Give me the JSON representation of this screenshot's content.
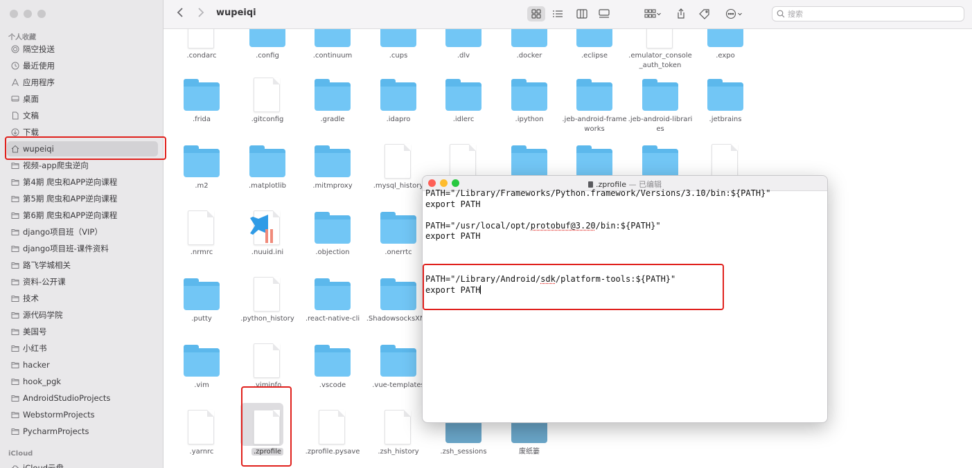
{
  "window": {
    "title": "wupeiqi",
    "colors": {
      "sidebar_bg": "#e9e8ea",
      "folder": "#72c6f5",
      "highlight": "#e0201c"
    }
  },
  "toolbar": {
    "back_icon": "chevron-left-icon",
    "forward_icon": "chevron-right-icon",
    "search_placeholder": "搜索"
  },
  "sidebar": {
    "section_favorites": "个人收藏",
    "section_icloud": "iCloud",
    "items": [
      {
        "label": "隔空投送",
        "icon": "airdrop-icon"
      },
      {
        "label": "最近使用",
        "icon": "clock-icon"
      },
      {
        "label": "应用程序",
        "icon": "apps-icon"
      },
      {
        "label": "桌面",
        "icon": "desktop-icon"
      },
      {
        "label": "文稿",
        "icon": "document-icon"
      },
      {
        "label": "下载",
        "icon": "download-icon"
      },
      {
        "label": "wupeiqi",
        "icon": "home-icon",
        "selected": true
      },
      {
        "label": "视频-app爬虫逆向",
        "icon": "folder-icon"
      },
      {
        "label": "第4期 爬虫和APP逆向课程",
        "icon": "folder-icon"
      },
      {
        "label": "第5期 爬虫和APP逆向课程",
        "icon": "folder-icon"
      },
      {
        "label": "第6期 爬虫和APP逆向课程",
        "icon": "folder-icon"
      },
      {
        "label": "django项目班（VIP）",
        "icon": "folder-icon"
      },
      {
        "label": "django项目班-课件资料",
        "icon": "folder-icon"
      },
      {
        "label": "路飞学城相关",
        "icon": "folder-icon"
      },
      {
        "label": "资料-公开课",
        "icon": "folder-icon"
      },
      {
        "label": "技术",
        "icon": "folder-icon"
      },
      {
        "label": "源代码学院",
        "icon": "folder-icon"
      },
      {
        "label": "美国号",
        "icon": "folder-icon"
      },
      {
        "label": "小红书",
        "icon": "folder-icon"
      },
      {
        "label": "hacker",
        "icon": "folder-icon"
      },
      {
        "label": "hook_pgk",
        "icon": "folder-icon"
      },
      {
        "label": "AndroidStudioProjects",
        "icon": "folder-icon"
      },
      {
        "label": "WebstormProjects",
        "icon": "folder-icon"
      },
      {
        "label": "PycharmProjects",
        "icon": "folder-icon"
      },
      {
        "label": "iCloud云盘",
        "icon": "icloud-icon"
      }
    ]
  },
  "files": {
    "row1": [
      {
        "name": ".condarc",
        "kind": "file"
      },
      {
        "name": ".config",
        "kind": "folder"
      },
      {
        "name": ".continuum",
        "kind": "folder"
      },
      {
        "name": ".cups",
        "kind": "folder"
      },
      {
        "name": ".dlv",
        "kind": "folder"
      },
      {
        "name": ".docker",
        "kind": "folder"
      },
      {
        "name": ".eclipse",
        "kind": "folder"
      },
      {
        "name": ".emulator_console_auth_token",
        "kind": "file"
      },
      {
        "name": ".expo",
        "kind": "folder"
      }
    ],
    "row2": [
      {
        "name": ".frida",
        "kind": "folder"
      },
      {
        "name": ".gitconfig",
        "kind": "file"
      },
      {
        "name": ".gradle",
        "kind": "folder"
      },
      {
        "name": ".idapro",
        "kind": "folder"
      },
      {
        "name": ".idlerc",
        "kind": "folder"
      },
      {
        "name": ".ipython",
        "kind": "folder"
      },
      {
        "name": ".jeb-android-frameworks",
        "kind": "folder"
      },
      {
        "name": ".jeb-android-libraries",
        "kind": "folder"
      },
      {
        "name": ".jetbrains",
        "kind": "folder"
      }
    ],
    "row3": [
      {
        "name": ".m2",
        "kind": "folder"
      },
      {
        "name": ".matplotlib",
        "kind": "folder"
      },
      {
        "name": ".mitmproxy",
        "kind": "folder"
      },
      {
        "name": ".mysql_history",
        "kind": "file"
      },
      {
        "name": "",
        "kind": "file"
      },
      {
        "name": "",
        "kind": "folder"
      },
      {
        "name": "",
        "kind": "folder"
      },
      {
        "name": "",
        "kind": "folder"
      },
      {
        "name": "",
        "kind": "file"
      }
    ],
    "row4": [
      {
        "name": ".nrmrc",
        "kind": "file"
      },
      {
        "name": ".nuuid.ini",
        "kind": "vscode"
      },
      {
        "name": ".objection",
        "kind": "folder"
      },
      {
        "name": ".onerrtc",
        "kind": "folder"
      }
    ],
    "row5": [
      {
        "name": ".putty",
        "kind": "folder"
      },
      {
        "name": ".python_history",
        "kind": "file"
      },
      {
        "name": ".react-native-cli",
        "kind": "folder"
      },
      {
        "name": ".ShadowsocksXNG",
        "kind": "folder"
      }
    ],
    "row6": [
      {
        "name": ".vim",
        "kind": "folder"
      },
      {
        "name": ".viminfo",
        "kind": "file"
      },
      {
        "name": ".vscode",
        "kind": "folder"
      },
      {
        "name": ".vue-templates",
        "kind": "folder"
      }
    ],
    "row7": [
      {
        "name": ".yarnrc",
        "kind": "file"
      },
      {
        "name": ".zprofile",
        "kind": "file",
        "selected": true
      },
      {
        "name": ".zprofile.pysave",
        "kind": "file"
      },
      {
        "name": ".zsh_history",
        "kind": "file"
      },
      {
        "name": ".zsh_sessions",
        "kind": "folder-dim"
      },
      {
        "name": "废纸篓",
        "kind": "folder-dim"
      }
    ]
  },
  "editor": {
    "file_name": ".zprofile",
    "separator": " — ",
    "state": "已编辑",
    "lines": [
      "PATH=\"/Library/Frameworks/Python.framework/Versions/3.10/bin:${PATH}\"",
      "export PATH",
      "",
      "PATH=\"/usr/local/opt/protobuf@3.20/bin:${PATH}\"",
      "export PATH",
      "",
      "",
      "",
      "PATH=\"/Library/Android/sdk/platform-tools:${PATH}\"",
      "export PATH"
    ]
  }
}
